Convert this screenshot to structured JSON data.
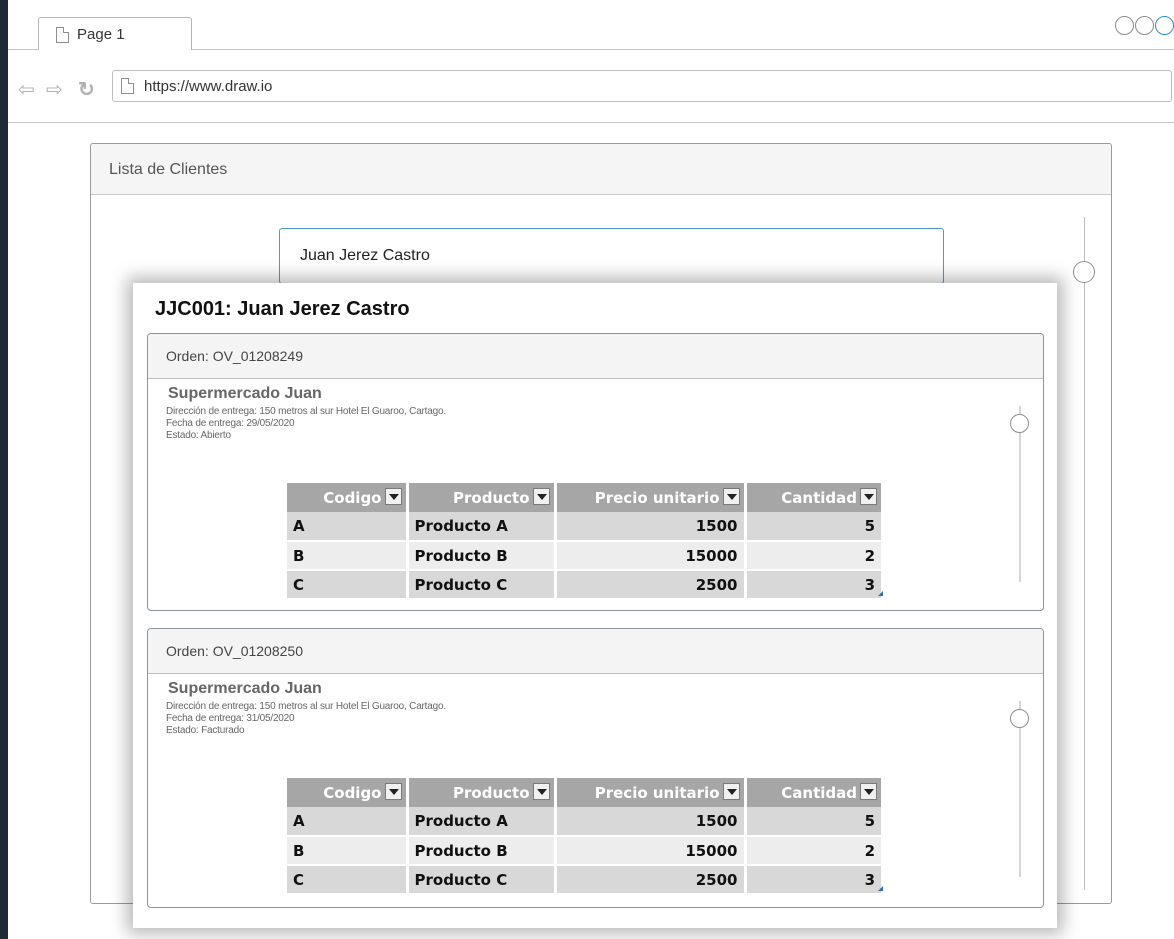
{
  "browser": {
    "tab_label": "Page 1",
    "url": "https://www.draw.io",
    "back_glyph": "⇦",
    "forward_glyph": "⇨",
    "reload_glyph": "↻"
  },
  "panel": {
    "title": "Lista de Clientes",
    "search_value": "Juan Jerez Castro"
  },
  "detail": {
    "title": "JJC001: Juan Jerez Castro",
    "orders": [
      {
        "label": "Orden: OV_01208249",
        "customer": "Supermercado Juan",
        "address": "Dirección de entrega: 150 metros al sur Hotel El Guaroo, Cartago.",
        "date": "Fecha de entrega: 29/05/2020",
        "status": "Estado: Abierto",
        "columns": [
          "Codigo",
          "Producto",
          "Precio unitario",
          "Cantidad"
        ],
        "rows": [
          {
            "codigo": "A",
            "producto": "Producto A",
            "precio": "1500",
            "cantidad": "5"
          },
          {
            "codigo": "B",
            "producto": "Producto B",
            "precio": "15000",
            "cantidad": "2"
          },
          {
            "codigo": "C",
            "producto": "Producto C",
            "precio": "2500",
            "cantidad": "3"
          }
        ]
      },
      {
        "label": "Orden: OV_01208250",
        "customer": "Supermercado Juan",
        "address": "Dirección de entrega: 150 metros al sur Hotel El Guaroo, Cartago.",
        "date": "Fecha de entrega: 31/05/2020",
        "status": "Estado: Facturado",
        "columns": [
          "Codigo",
          "Producto",
          "Precio unitario",
          "Cantidad"
        ],
        "rows": [
          {
            "codigo": "A",
            "producto": "Producto A",
            "precio": "1500",
            "cantidad": "5"
          },
          {
            "codigo": "B",
            "producto": "Producto B",
            "precio": "15000",
            "cantidad": "2"
          },
          {
            "codigo": "C",
            "producto": "Producto C",
            "precio": "2500",
            "cantidad": "3"
          }
        ]
      }
    ]
  },
  "colors": {
    "accent": "#4a9ad4",
    "header_gray": "#a6a6a6",
    "row_dark": "#d8d8d8",
    "row_light": "#ededed"
  }
}
